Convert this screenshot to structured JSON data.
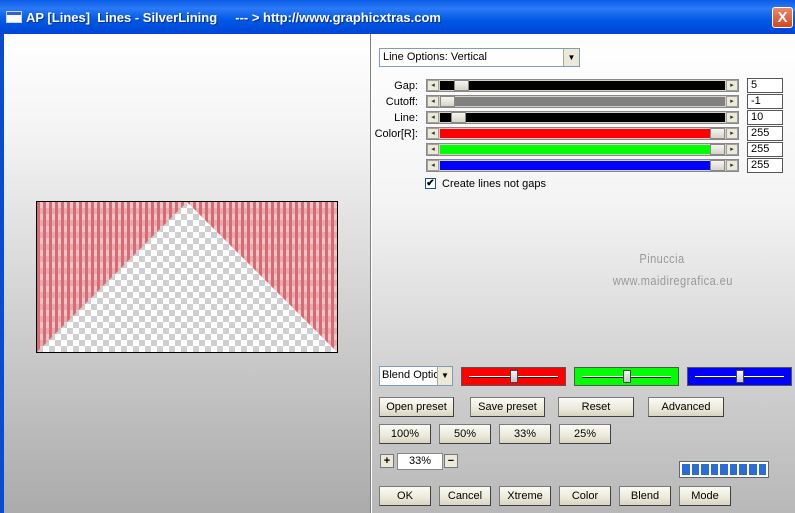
{
  "window": {
    "title": "AP [Lines]  Lines - SilverLining     --- > http://www.graphicxtras.com",
    "close_glyph": "X"
  },
  "options": {
    "dropdown_value": "Line Options: Vertical",
    "dropdown_arrow": "▼"
  },
  "sliders": [
    {
      "label": "Gap:",
      "value": "5",
      "color": "#000000",
      "level": 0.05
    },
    {
      "label": "Cutoff:",
      "value": "-1",
      "color": "#808080",
      "level": 0.0
    },
    {
      "label": "Line:",
      "value": "10",
      "color": "#000000",
      "level": 0.04
    },
    {
      "label": "Color[R]:",
      "value": "255",
      "color": "#ff0000",
      "level": 1.0
    },
    {
      "label": "",
      "value": "255",
      "color": "#00ff00",
      "level": 1.0
    },
    {
      "label": "",
      "value": "255",
      "color": "#0000ff",
      "level": 1.0
    }
  ],
  "slider_arrows": {
    "left": "◂",
    "right": "▸"
  },
  "checkbox": {
    "label": "Create lines not gaps",
    "checked": true,
    "glyph": "✔"
  },
  "watermark": {
    "line1": "Pinuccia",
    "line2": "www.maidiregrafica.eu"
  },
  "blend": {
    "select_value": "Blend Optio",
    "boxes": [
      {
        "color": "#ff0000",
        "level": 0.5
      },
      {
        "color": "#00ff00",
        "level": 0.5
      },
      {
        "color": "#0000ff",
        "level": 0.5
      }
    ]
  },
  "buttons": {
    "open_preset": "Open preset",
    "save_preset": "Save preset",
    "reset": "Reset",
    "advanced": "Advanced",
    "z100": "100%",
    "z50": "50%",
    "z33": "33%",
    "z25": "25%",
    "ok": "OK",
    "cancel": "Cancel",
    "xtreme": "Xtreme",
    "color": "Color",
    "blend": "Blend",
    "mode": "Mode"
  },
  "zoom": {
    "plus": "+",
    "value": "33%",
    "minus": "−"
  },
  "progress_blocks": 9,
  "colors": {
    "accent": "#0054e3",
    "preview_stripe": "#d9848a"
  }
}
